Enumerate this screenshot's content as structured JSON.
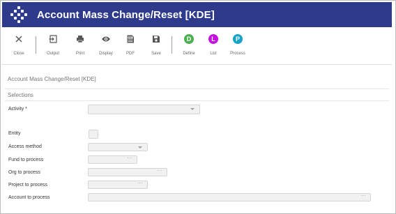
{
  "window": {
    "title": "Account Mass Change/Reset [KDE]"
  },
  "toolbar": {
    "close": "Close",
    "output": "Output",
    "print": "Print",
    "display": "Display",
    "pdf": "PDF",
    "save": "Save",
    "define": "Define",
    "list": "List",
    "process": "Process",
    "define_letter": "D",
    "list_letter": "L",
    "process_letter": "P",
    "pdf_badge": "PDF",
    "colors": {
      "define": "#4caf50",
      "list": "#c511e0",
      "process": "#17a2c8"
    }
  },
  "page": {
    "title": "Account Mass Change/Reset [KDE]",
    "section": "Selections"
  },
  "fields": {
    "activity": "Activity *",
    "entity": "Entity",
    "access_method": "Access method",
    "fund": "Fund to process",
    "org": "Org to process",
    "project": "Project to process",
    "account": "Account to process",
    "lookup_glyph": "···"
  },
  "theme": {
    "titlebar": "#2e3a8c"
  }
}
